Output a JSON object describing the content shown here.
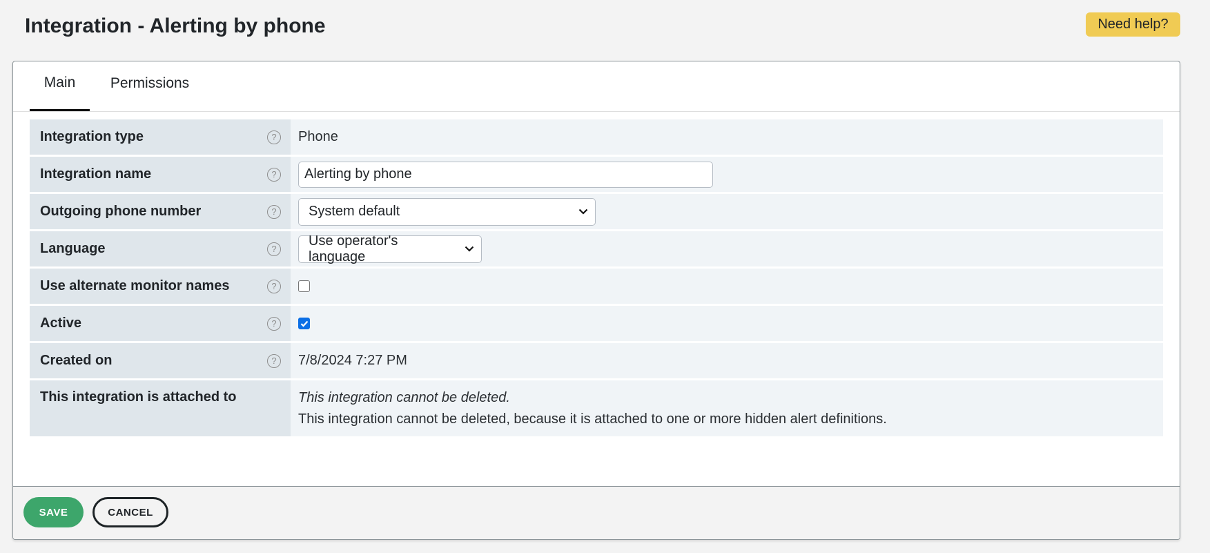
{
  "header": {
    "title": "Integration - Alerting by phone",
    "help_button": "Need help?"
  },
  "tabs": [
    {
      "label": "Main",
      "active": true
    },
    {
      "label": "Permissions",
      "active": false
    }
  ],
  "form": {
    "help_glyph": "?",
    "integration_type": {
      "label": "Integration type",
      "value": "Phone"
    },
    "integration_name": {
      "label": "Integration name",
      "value": "Alerting by phone"
    },
    "outgoing_phone": {
      "label": "Outgoing phone number",
      "selected": "System default"
    },
    "language": {
      "label": "Language",
      "selected": "Use operator's language"
    },
    "alternate_names": {
      "label": "Use alternate monitor names",
      "checked": false
    },
    "active": {
      "label": "Active",
      "checked": true
    },
    "created_on": {
      "label": "Created on",
      "value": "7/8/2024 7:27 PM"
    },
    "attached_to": {
      "label": "This integration is attached to",
      "note_italic": "This integration cannot be deleted.",
      "note": "This integration cannot be deleted, because it is attached to one or more hidden alert definitions."
    }
  },
  "footer": {
    "save_label": "SAVE",
    "cancel_label": "CANCEL"
  },
  "colors": {
    "help_button": "#f0cb54",
    "save_button": "#3da66b",
    "checkbox_checked": "#0b6fe6",
    "label_cell": "#dfe6eb",
    "value_cell": "#f0f4f7"
  }
}
